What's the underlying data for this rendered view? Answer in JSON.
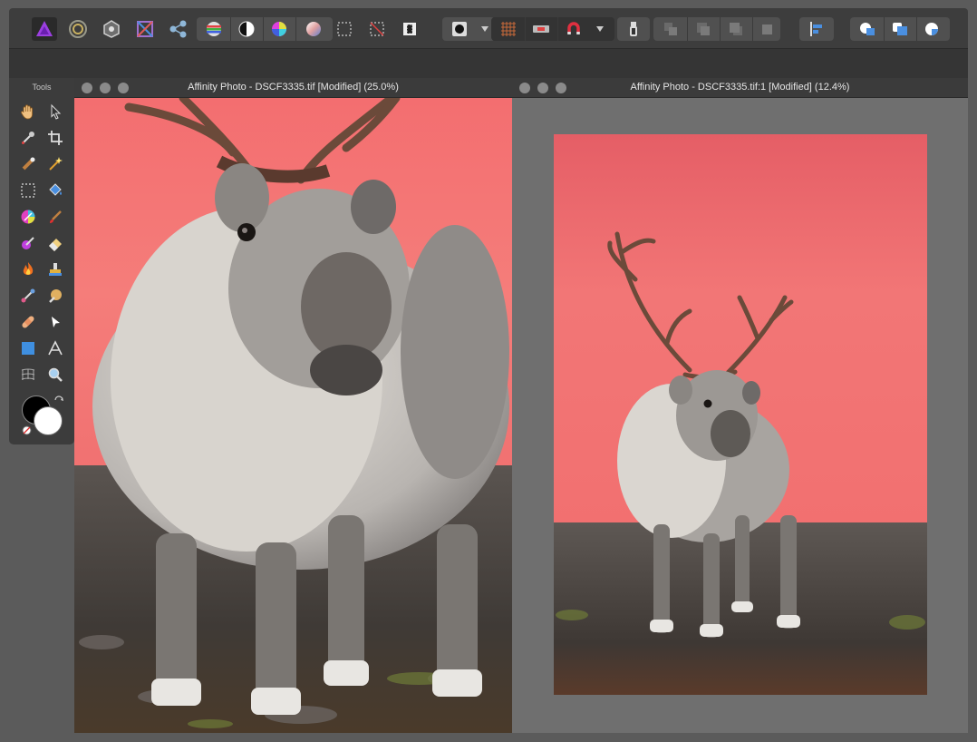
{
  "windows": [
    {
      "title": "Affinity Photo - DSCF3335.tif [Modified] (25.0%)"
    },
    {
      "title": "Affinity Photo - DSCF3335.tif:1 [Modified] (12.4%)"
    }
  ],
  "tools_panel": {
    "title": "Tools"
  },
  "colors": {
    "sky": "#f07a78",
    "sky_top": "#f36e70",
    "ground": "#4a4440",
    "canvas_gray": "#6f6f6f",
    "fill_blue": "#3f8fe0"
  },
  "toolbar_icons": [
    "affinity-photo-persona-icon",
    "liquify-persona-icon",
    "develop-persona-icon",
    "tone-mapping-persona-icon",
    "export-persona-icon",
    "auto-levels-icon",
    "auto-contrast-icon",
    "auto-colors-icon",
    "auto-white-balance-icon",
    "selection-mode-icon",
    "deselect-icon",
    "invert-selection-icon",
    "quick-mask-icon",
    "grid-icon",
    "assistant-icon",
    "snapping-icon",
    "mode-icon",
    "order-back-icon",
    "order-backward-icon",
    "order-forward-icon",
    "order-front-icon",
    "align-icon",
    "boolean-add-icon",
    "boolean-subtract-icon",
    "boolean-intersect-icon"
  ]
}
